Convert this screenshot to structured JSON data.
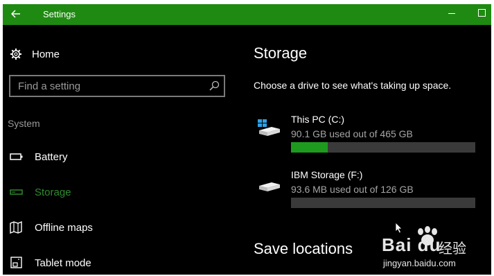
{
  "window": {
    "title": "Settings"
  },
  "colors": {
    "titlebar": "#1f8a12",
    "accent": "#1e9b1e",
    "active_nav": "#2e8b2e"
  },
  "sidebar": {
    "home_label": "Home",
    "search_placeholder": "Find a setting",
    "section_label": "System",
    "items": [
      {
        "label": "Battery",
        "icon": "battery-icon",
        "active": false
      },
      {
        "label": "Storage",
        "icon": "storage-icon",
        "active": true
      },
      {
        "label": "Offline maps",
        "icon": "map-icon",
        "active": false
      },
      {
        "label": "Tablet mode",
        "icon": "tablet-mode-icon",
        "active": false
      }
    ]
  },
  "main": {
    "title": "Storage",
    "subtitle": "Choose a drive to see what's taking up space.",
    "drives": [
      {
        "name": "This PC (C:)",
        "used": "90.1 GB used out of 465 GB",
        "used_fraction": 0.2,
        "icon": "windows-drive-icon"
      },
      {
        "name": "IBM Storage (F:)",
        "used": "93.6 MB used out of 126 GB",
        "used_fraction": 0.0,
        "icon": "drive-icon"
      }
    ],
    "save_locations": "Save locations"
  },
  "watermark": {
    "logo": "Bai du",
    "text": "经验",
    "url": "jingyan.baidu.com"
  }
}
